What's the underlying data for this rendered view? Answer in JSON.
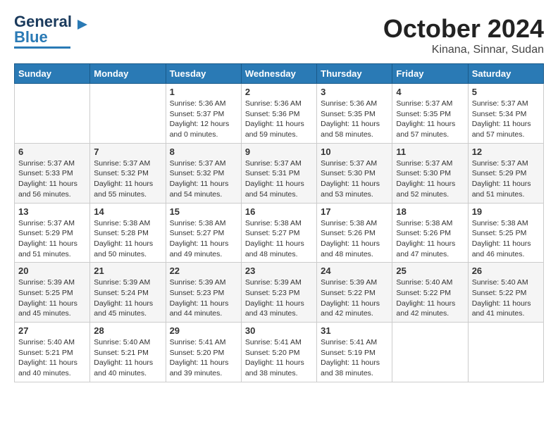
{
  "header": {
    "logo_general": "General",
    "logo_blue": "Blue",
    "month_title": "October 2024",
    "location": "Kinana, Sinnar, Sudan"
  },
  "days_of_week": [
    "Sunday",
    "Monday",
    "Tuesday",
    "Wednesday",
    "Thursday",
    "Friday",
    "Saturday"
  ],
  "weeks": [
    [
      {
        "day": "",
        "info": ""
      },
      {
        "day": "",
        "info": ""
      },
      {
        "day": "1",
        "info": "Sunrise: 5:36 AM\nSunset: 5:37 PM\nDaylight: 12 hours\nand 0 minutes."
      },
      {
        "day": "2",
        "info": "Sunrise: 5:36 AM\nSunset: 5:36 PM\nDaylight: 11 hours\nand 59 minutes."
      },
      {
        "day": "3",
        "info": "Sunrise: 5:36 AM\nSunset: 5:35 PM\nDaylight: 11 hours\nand 58 minutes."
      },
      {
        "day": "4",
        "info": "Sunrise: 5:37 AM\nSunset: 5:35 PM\nDaylight: 11 hours\nand 57 minutes."
      },
      {
        "day": "5",
        "info": "Sunrise: 5:37 AM\nSunset: 5:34 PM\nDaylight: 11 hours\nand 57 minutes."
      }
    ],
    [
      {
        "day": "6",
        "info": "Sunrise: 5:37 AM\nSunset: 5:33 PM\nDaylight: 11 hours\nand 56 minutes."
      },
      {
        "day": "7",
        "info": "Sunrise: 5:37 AM\nSunset: 5:32 PM\nDaylight: 11 hours\nand 55 minutes."
      },
      {
        "day": "8",
        "info": "Sunrise: 5:37 AM\nSunset: 5:32 PM\nDaylight: 11 hours\nand 54 minutes."
      },
      {
        "day": "9",
        "info": "Sunrise: 5:37 AM\nSunset: 5:31 PM\nDaylight: 11 hours\nand 54 minutes."
      },
      {
        "day": "10",
        "info": "Sunrise: 5:37 AM\nSunset: 5:30 PM\nDaylight: 11 hours\nand 53 minutes."
      },
      {
        "day": "11",
        "info": "Sunrise: 5:37 AM\nSunset: 5:30 PM\nDaylight: 11 hours\nand 52 minutes."
      },
      {
        "day": "12",
        "info": "Sunrise: 5:37 AM\nSunset: 5:29 PM\nDaylight: 11 hours\nand 51 minutes."
      }
    ],
    [
      {
        "day": "13",
        "info": "Sunrise: 5:37 AM\nSunset: 5:29 PM\nDaylight: 11 hours\nand 51 minutes."
      },
      {
        "day": "14",
        "info": "Sunrise: 5:38 AM\nSunset: 5:28 PM\nDaylight: 11 hours\nand 50 minutes."
      },
      {
        "day": "15",
        "info": "Sunrise: 5:38 AM\nSunset: 5:27 PM\nDaylight: 11 hours\nand 49 minutes."
      },
      {
        "day": "16",
        "info": "Sunrise: 5:38 AM\nSunset: 5:27 PM\nDaylight: 11 hours\nand 48 minutes."
      },
      {
        "day": "17",
        "info": "Sunrise: 5:38 AM\nSunset: 5:26 PM\nDaylight: 11 hours\nand 48 minutes."
      },
      {
        "day": "18",
        "info": "Sunrise: 5:38 AM\nSunset: 5:26 PM\nDaylight: 11 hours\nand 47 minutes."
      },
      {
        "day": "19",
        "info": "Sunrise: 5:38 AM\nSunset: 5:25 PM\nDaylight: 11 hours\nand 46 minutes."
      }
    ],
    [
      {
        "day": "20",
        "info": "Sunrise: 5:39 AM\nSunset: 5:25 PM\nDaylight: 11 hours\nand 45 minutes."
      },
      {
        "day": "21",
        "info": "Sunrise: 5:39 AM\nSunset: 5:24 PM\nDaylight: 11 hours\nand 45 minutes."
      },
      {
        "day": "22",
        "info": "Sunrise: 5:39 AM\nSunset: 5:23 PM\nDaylight: 11 hours\nand 44 minutes."
      },
      {
        "day": "23",
        "info": "Sunrise: 5:39 AM\nSunset: 5:23 PM\nDaylight: 11 hours\nand 43 minutes."
      },
      {
        "day": "24",
        "info": "Sunrise: 5:39 AM\nSunset: 5:22 PM\nDaylight: 11 hours\nand 42 minutes."
      },
      {
        "day": "25",
        "info": "Sunrise: 5:40 AM\nSunset: 5:22 PM\nDaylight: 11 hours\nand 42 minutes."
      },
      {
        "day": "26",
        "info": "Sunrise: 5:40 AM\nSunset: 5:22 PM\nDaylight: 11 hours\nand 41 minutes."
      }
    ],
    [
      {
        "day": "27",
        "info": "Sunrise: 5:40 AM\nSunset: 5:21 PM\nDaylight: 11 hours\nand 40 minutes."
      },
      {
        "day": "28",
        "info": "Sunrise: 5:40 AM\nSunset: 5:21 PM\nDaylight: 11 hours\nand 40 minutes."
      },
      {
        "day": "29",
        "info": "Sunrise: 5:41 AM\nSunset: 5:20 PM\nDaylight: 11 hours\nand 39 minutes."
      },
      {
        "day": "30",
        "info": "Sunrise: 5:41 AM\nSunset: 5:20 PM\nDaylight: 11 hours\nand 38 minutes."
      },
      {
        "day": "31",
        "info": "Sunrise: 5:41 AM\nSunset: 5:19 PM\nDaylight: 11 hours\nand 38 minutes."
      },
      {
        "day": "",
        "info": ""
      },
      {
        "day": "",
        "info": ""
      }
    ]
  ]
}
